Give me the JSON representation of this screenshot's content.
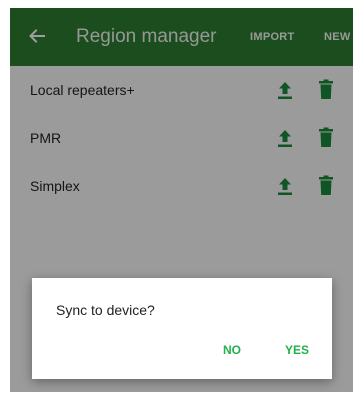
{
  "appbar": {
    "title": "Region manager",
    "import_label": "IMPORT",
    "new_label": "NEW",
    "back_icon": "arrow-left-icon",
    "background_color": "#2e7d32"
  },
  "regions": [
    {
      "name": "Local repeaters+"
    },
    {
      "name": "PMR"
    },
    {
      "name": "Simplex"
    }
  ],
  "row_icons": {
    "upload_icon": "upload-icon",
    "delete_icon": "trash-icon",
    "icon_color": "#1b8a3a"
  },
  "dialog": {
    "message": "Sync to device?",
    "no_label": "NO",
    "yes_label": "YES",
    "button_color": "#22b14c"
  }
}
